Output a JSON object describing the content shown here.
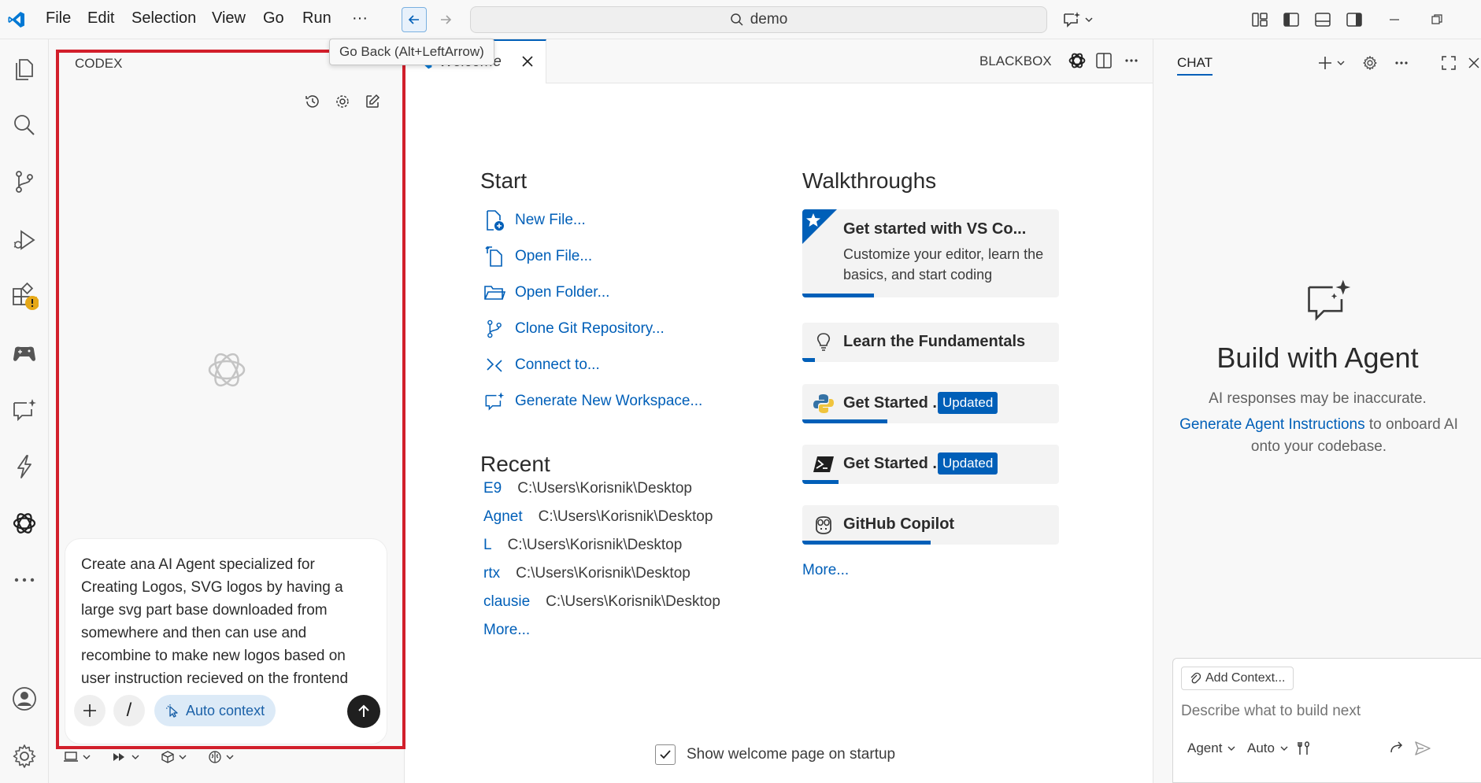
{
  "titlebar": {
    "menus": [
      "File",
      "Edit",
      "Selection",
      "View",
      "Go",
      "Run",
      "···"
    ],
    "search_text": "demo"
  },
  "tooltip": {
    "text": "Go Back (Alt+LeftArrow)"
  },
  "codex": {
    "title": "CODEX",
    "composer_text": "Create ana AI Agent specialized for Creating Logos, SVG logos by having a large svg part base downloaded from somewhere and then can use and recombine to make new logos based on user instruction recieved on the frontend",
    "slash_label": "/",
    "auto_context_label": "Auto context"
  },
  "editor": {
    "tab_label": "Welcome",
    "blackbox_label": "BLACKBOX",
    "start_title": "Start",
    "start_items": [
      "New File...",
      "Open File...",
      "Open Folder...",
      "Clone Git Repository...",
      "Connect to...",
      "Generate New Workspace..."
    ],
    "recent_title": "Recent",
    "recent_items": [
      {
        "name": "E9",
        "path": "C:\\Users\\Korisnik\\Desktop"
      },
      {
        "name": "Agnet",
        "path": "C:\\Users\\Korisnik\\Desktop"
      },
      {
        "name": "L",
        "path": "C:\\Users\\Korisnik\\Desktop"
      },
      {
        "name": "rtx",
        "path": "C:\\Users\\Korisnik\\Desktop"
      },
      {
        "name": "clausie",
        "path": "C:\\Users\\Korisnik\\Desktop"
      }
    ],
    "recent_more": "More...",
    "walkthroughs_title": "Walkthroughs",
    "walkthroughs": [
      {
        "title": "Get started with VS Co...",
        "desc": "Customize your editor, learn the basics, and start coding",
        "progress": 0.28
      },
      {
        "title": "Learn the Fundamentals",
        "progress": 0.05
      },
      {
        "title": "Get Started ...",
        "badge": "Updated",
        "progress": 0.33
      },
      {
        "title": "Get Started ...",
        "badge": "Updated",
        "progress": 0.14
      },
      {
        "title": "GitHub Copilot",
        "progress": 0.5
      }
    ],
    "walkthroughs_more": "More...",
    "startup_label": "Show welcome page on startup",
    "startup_checked": true
  },
  "chat": {
    "tab_label": "CHAT",
    "heading": "Build with Agent",
    "disclaimer": "AI responses may be inaccurate.",
    "hint_link": "Generate Agent Instructions",
    "hint_rest": " to onboard AI onto your codebase.",
    "add_context": "Add Context...",
    "input_placeholder": "Describe what to build next",
    "mode": "Agent",
    "model": "Auto"
  },
  "colors": {
    "accent": "#005fb8",
    "highlight_frame": "#d21f2b"
  }
}
